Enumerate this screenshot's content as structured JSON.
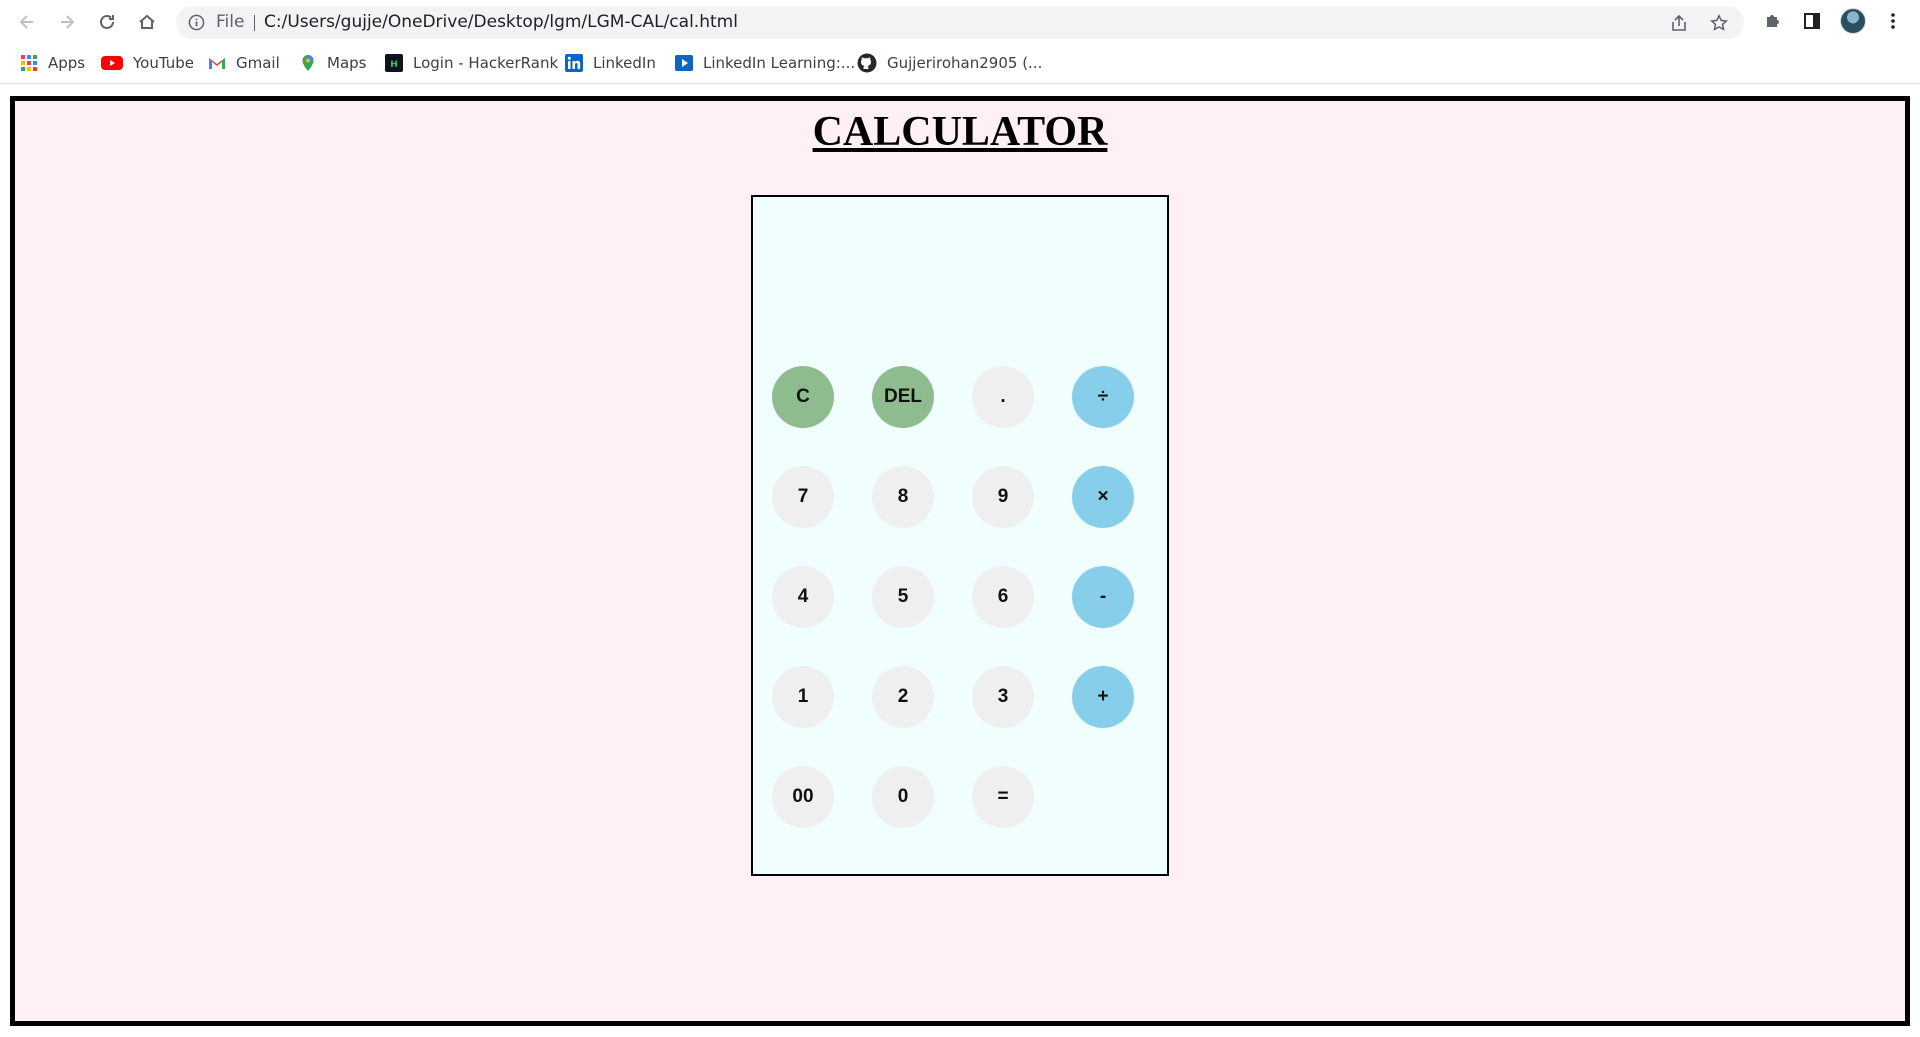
{
  "browser": {
    "omnibox": {
      "scheme_label": "File",
      "url": "C:/Users/gujje/OneDrive/Desktop/lgm/LGM-CAL/cal.html"
    },
    "icons": {
      "back": "arrow-left-icon",
      "forward": "arrow-right-icon",
      "reload": "reload-icon",
      "home": "home-icon",
      "info": "info-icon",
      "share": "share-icon",
      "bookmark": "star-icon",
      "extensions": "puzzle-icon",
      "side_panel": "side-panel-icon",
      "menu": "kebab-menu-icon"
    },
    "bookmarks": [
      {
        "label": "Apps",
        "icon": "apps-grid-icon"
      },
      {
        "label": "YouTube",
        "icon": "youtube-icon"
      },
      {
        "label": "Gmail",
        "icon": "gmail-icon"
      },
      {
        "label": "Maps",
        "icon": "maps-pin-icon"
      },
      {
        "label": "Login - HackerRank",
        "icon": "hackerrank-icon"
      },
      {
        "label": "LinkedIn",
        "icon": "linkedin-icon"
      },
      {
        "label": "LinkedIn Learning:...",
        "icon": "linkedin-learning-icon"
      },
      {
        "label": "Gujjerirohan2905 (...",
        "icon": "github-icon"
      }
    ]
  },
  "page": {
    "title": "CALCULATOR",
    "display_value": "",
    "colors": {
      "page_background": "#fff0f5",
      "calculator_background": "#f0fffe",
      "clear_keys": "#8fbc8f",
      "operator_keys": "#87ceeb",
      "digit_keys": "#efefef"
    },
    "keys": {
      "clear": "C",
      "delete": "DEL",
      "decimal": ".",
      "divide": "÷",
      "seven": "7",
      "eight": "8",
      "nine": "9",
      "multiply": "×",
      "four": "4",
      "five": "5",
      "six": "6",
      "subtract": "-",
      "one": "1",
      "two": "2",
      "three": "3",
      "add": "+",
      "double_zero": "00",
      "zero": "0",
      "equals": "="
    }
  }
}
